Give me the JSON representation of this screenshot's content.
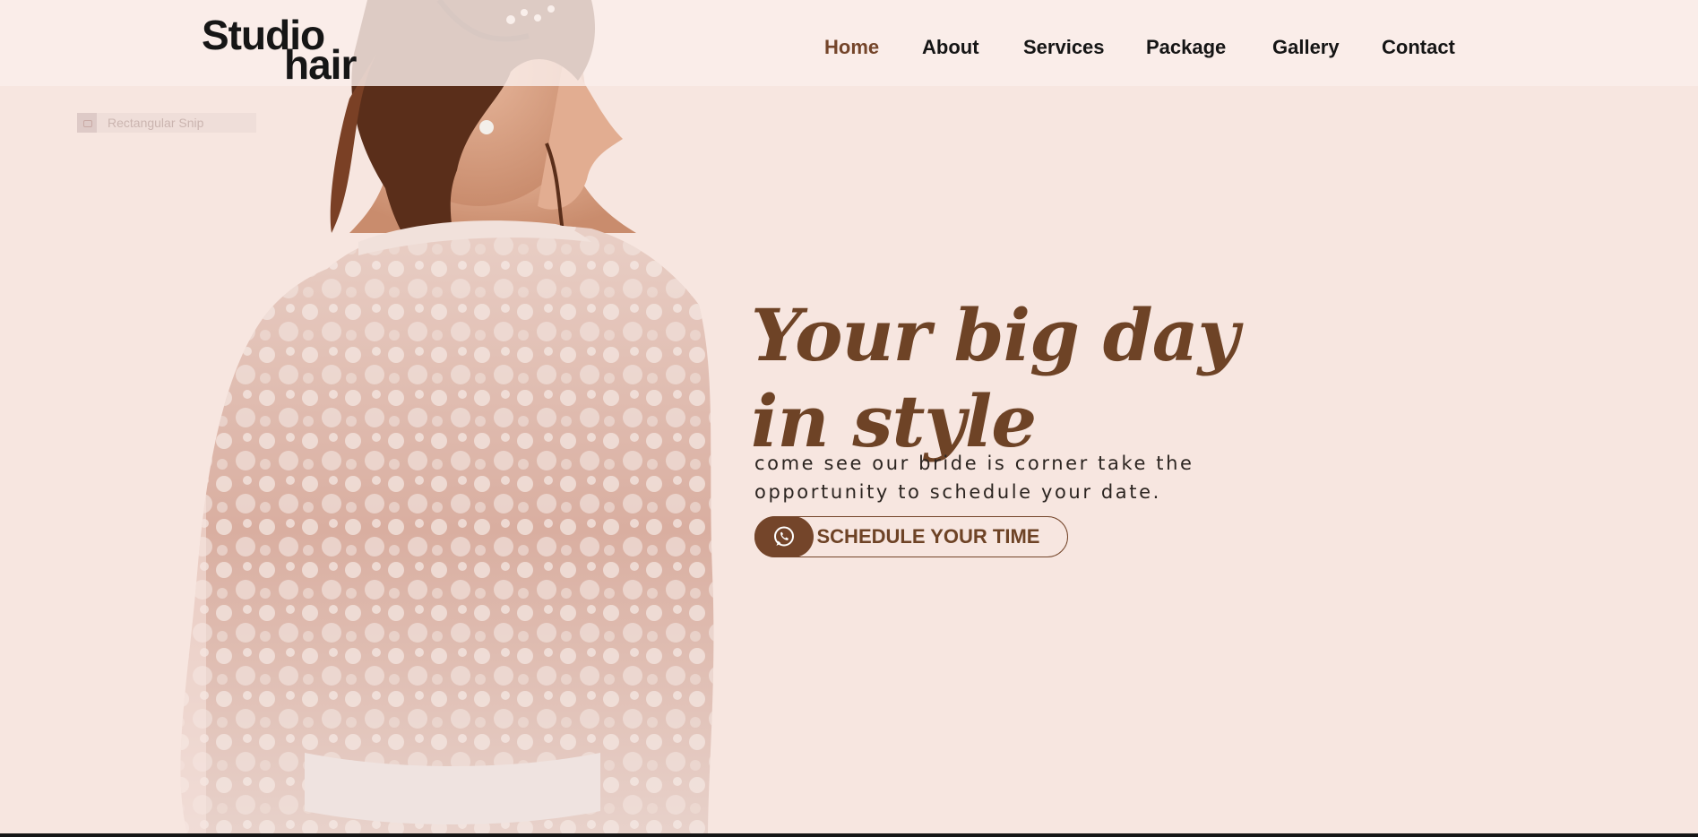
{
  "brand": {
    "logo_word_1": "Studio",
    "logo_word_2": "hair"
  },
  "nav": {
    "items": [
      {
        "label": "Home",
        "active": true
      },
      {
        "label": "About",
        "active": false
      },
      {
        "label": "Services",
        "active": false
      },
      {
        "label": "Package",
        "active": false
      },
      {
        "label": "Gallery",
        "active": false
      },
      {
        "label": "Contact",
        "active": false
      }
    ]
  },
  "overlay": {
    "snip_label": "Rectangular Snip"
  },
  "hero": {
    "headline_line_1": "Your big day",
    "headline_line_2": "in style",
    "subtext_line_1": "come see our bride is corner take the",
    "subtext_line_2": "opportunity to schedule your date.",
    "cta_label": "SCHEDULE YOUR TIME",
    "cta_icon": "whatsapp-icon"
  },
  "colors": {
    "background": "#f7e6e0",
    "header": "#faeeea",
    "accent": "#74452a",
    "text_dark": "#151515"
  }
}
